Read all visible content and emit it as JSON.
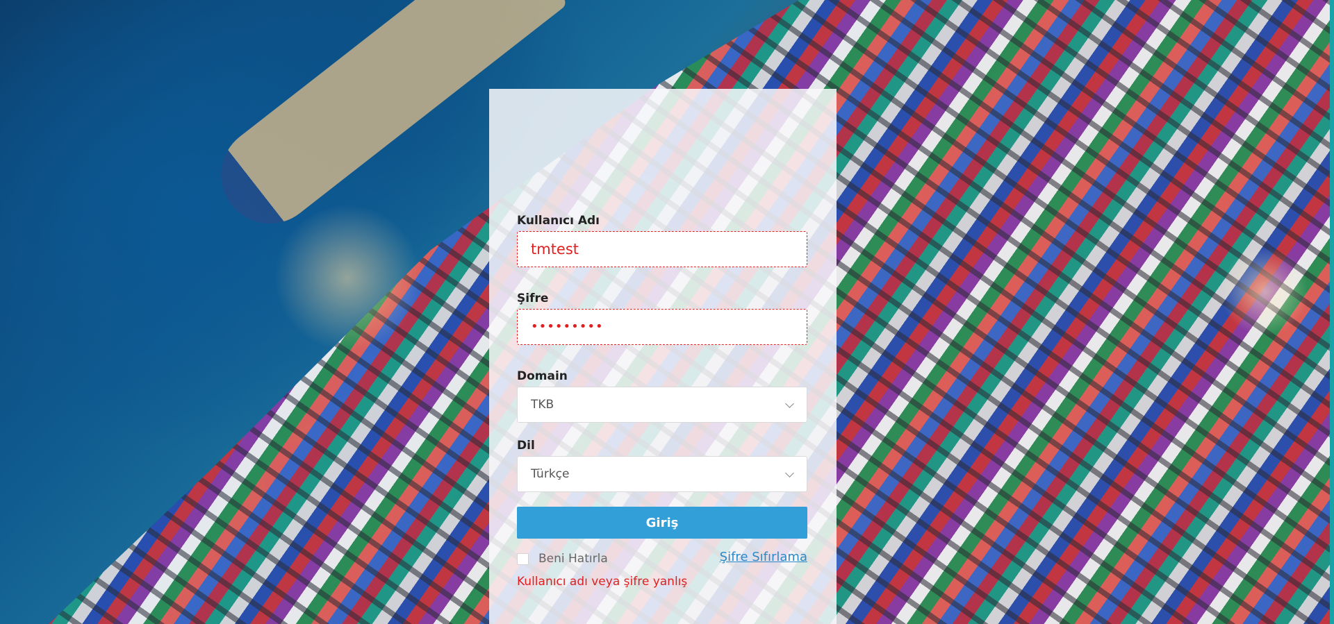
{
  "login": {
    "username_label": "Kullanıcı Adı",
    "username_value": "tmtest",
    "password_label": "Şifre",
    "password_value": "•••••••••",
    "domain_label": "Domain",
    "domain_selected": "TKB",
    "language_label": "Dil",
    "language_selected": "Türkçe",
    "submit_label": "Giriş",
    "remember_label": "Beni Hatırla",
    "reset_link": "Şifre Sıfırlama",
    "error_message": "Kullanıcı adı veya şifre yanlış"
  },
  "colors": {
    "primary_button": "#329fd9",
    "error": "#e02020",
    "link": "#2b89c8"
  }
}
